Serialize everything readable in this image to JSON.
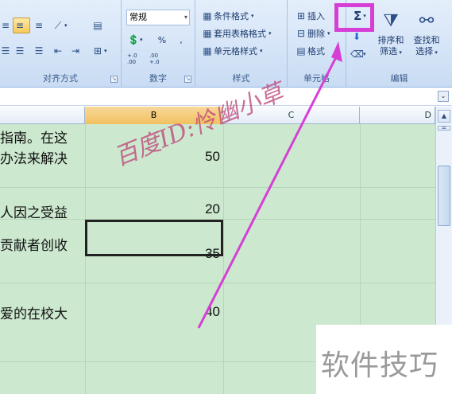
{
  "ribbon": {
    "alignment": {
      "label": "对齐方式"
    },
    "number": {
      "label": "数字",
      "format_value": "常规",
      "percent": "%",
      "comma": ",",
      "inc_decimal": "+.0 .00",
      "dec_decimal": ".00 +.0"
    },
    "styles": {
      "label": "样式",
      "conditional_format": "条件格式",
      "table_format": "套用表格格式",
      "cell_styles": "单元格样式"
    },
    "cells": {
      "label": "单元格",
      "insert": "插入",
      "delete": "删除",
      "format": "格式"
    },
    "editing": {
      "label": "编辑",
      "sum": "Σ",
      "sort_filter_l1": "排序和",
      "sort_filter_l2": "筛选",
      "find_select_l1": "查找和",
      "find_select_l2": "选择"
    }
  },
  "sheet": {
    "columns": [
      "B",
      "C",
      "D"
    ],
    "rows": [
      {
        "a_line1": "指南。在这",
        "a_line2": "办法来解决",
        "b": "50"
      },
      {
        "a_line1": "人因之受益",
        "b": "20"
      },
      {
        "a_line1": "贡献者创收",
        "b": "35"
      },
      {
        "a_line1": "爱的在校大",
        "b": "40"
      }
    ]
  },
  "overlay": {
    "watermark": "百度ID:怜幽小草",
    "corner_text": "软件技巧",
    "highlight_color": "#d63fd6"
  }
}
